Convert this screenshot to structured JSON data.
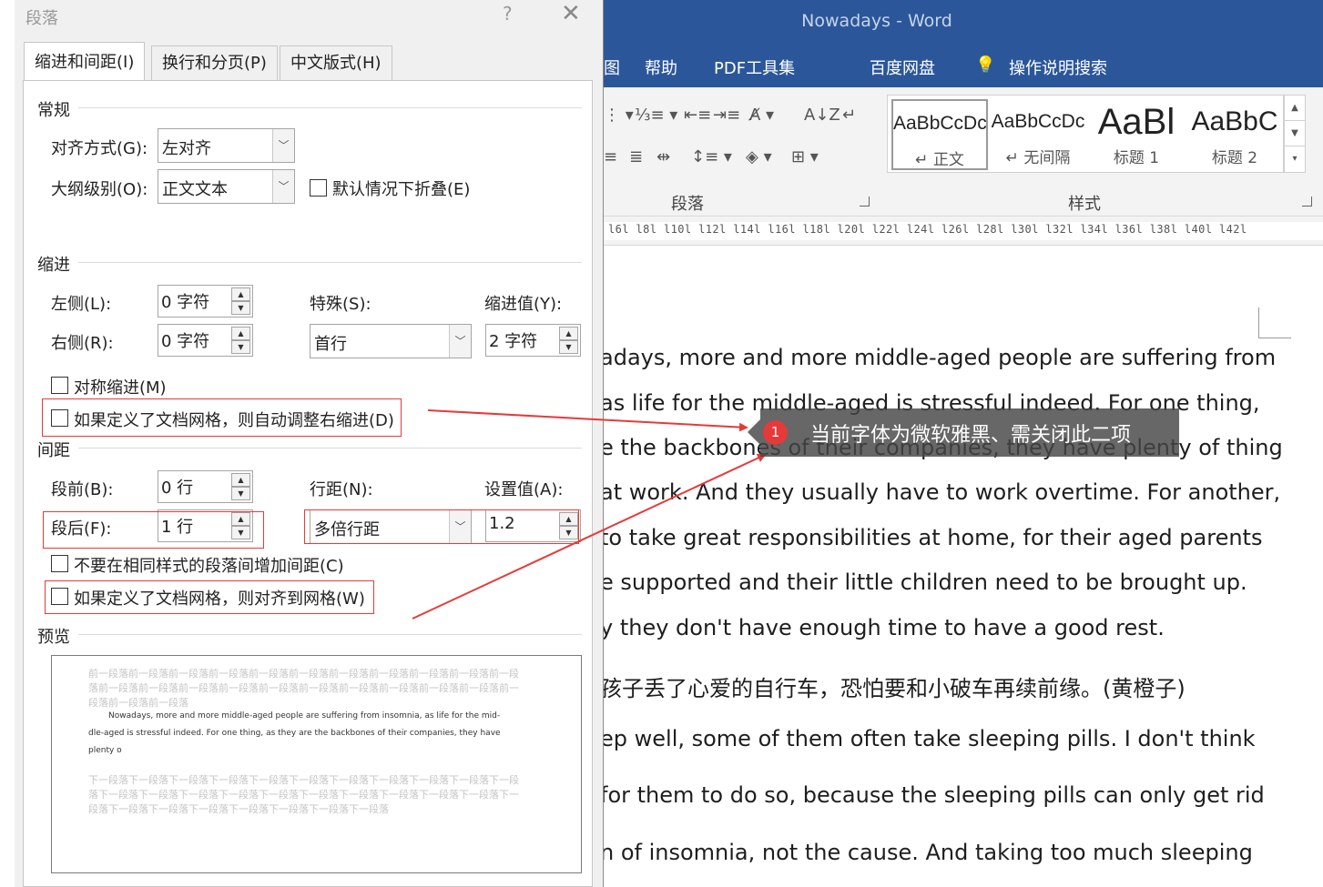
{
  "word": {
    "title": "Nowadays  -  Word",
    "tabs": [
      "图",
      "帮助",
      "PDF工具集",
      "百度网盘",
      "操作说明搜索"
    ],
    "groups": {
      "paragraph": "段落",
      "styles": "样式"
    },
    "styles": [
      {
        "sample": "AaBbCcDc",
        "name": "↵ 正文"
      },
      {
        "sample": "AaBbCcDc",
        "name": "↵ 无间隔"
      },
      {
        "sample": "AaBl",
        "name": "标题 1"
      },
      {
        "sample": "AaBbC",
        "name": "标题 2"
      }
    ],
    "ruler": "l6l  l8l  l10l  l12l  l14l  l16l  l18l  l20l  l22l  l24l  l26l  l28l  l30l  l32l  l34l  l36l  l38l  l40l  l42l",
    "doc_lines": [
      "adays, more and more middle-aged people are suffering from",
      "as life for the middle-aged is stressful indeed. For one thing,",
      "e the backbones of their companies, they have plenty of thing",
      "at work. And they usually have to work overtime. For another,",
      "to take great responsibilities at home, for their aged parents",
      "e supported and their little children need to be brought up.",
      "y they don't have enough time to have a good rest.",
      "孩子丢了心爱的自行车，恐怕要和小破车再续前缘。(黄橙子)",
      "ep well, some of them often take sleeping pills. I don't think",
      "for them to do so, because the sleeping pills can only get rid",
      "n of insomnia, not the cause. And taking too much sleeping"
    ]
  },
  "dialog": {
    "title": "段落",
    "help": "?",
    "close": "✕",
    "tabs": [
      "缩进和间距(I)",
      "换行和分页(P)",
      "中文版式(H)"
    ],
    "general": {
      "section": "常规",
      "align_label": "对齐方式(G):",
      "align_value": "左对齐",
      "outline_label": "大纲级别(O):",
      "outline_value": "正文文本",
      "collapse_label": "默认情况下折叠(E)"
    },
    "indent": {
      "section": "缩进",
      "left_label": "左侧(L):",
      "left_value": "0 字符",
      "right_label": "右侧(R):",
      "right_value": "0 字符",
      "special_label": "特殊(S):",
      "special_value": "首行",
      "by_label": "缩进值(Y):",
      "by_value": "2 字符",
      "mirror_label": "对称缩进(M)",
      "grid_label": "如果定义了文档网格，则自动调整右缩进(D)"
    },
    "spacing": {
      "section": "间距",
      "before_label": "段前(B):",
      "before_value": "0 行",
      "after_label": "段后(F):",
      "after_value": "1 行",
      "line_label": "行距(N):",
      "line_value": "多倍行距",
      "at_label": "设置值(A):",
      "at_value": "1.2",
      "nosame_label": "不要在相同样式的段落间增加间距(C)",
      "snap_label": "如果定义了文档网格，则对齐到网格(W)"
    },
    "preview": {
      "section": "预览",
      "before_text": "前一段落前一段落前一段落前一段落前一段落前一段落前一段落前一段落前一段落前一段落前一段落前一段落前一段落前一段落前一段落前一段落前一段落前一段落前一段落前一段落前一段落前一段落前一段落前一段落",
      "sample_lines": [
        "Nowadays, more and more middle-aged people are suffering from insomnia, as life for the mid-",
        "dle-aged is stressful indeed. For one thing, as they are the backbones of their companies, they have",
        "plenty o"
      ],
      "after_text": "下一段落下一段落下一段落下一段落下一段落下一段落下一段落下一段落下一段落下一段落下一段落下一段落下一段落下一段落下一段落下一段落下一段落下一段落下一段落下一段落下一段落下一段落下一段落下一段落下一段落下一段落下一段落下一段落下一段落"
    }
  },
  "annotation": {
    "number": "1",
    "text": "当前字体为微软雅黑、需关闭此二项",
    "color": "#e53a3a"
  }
}
